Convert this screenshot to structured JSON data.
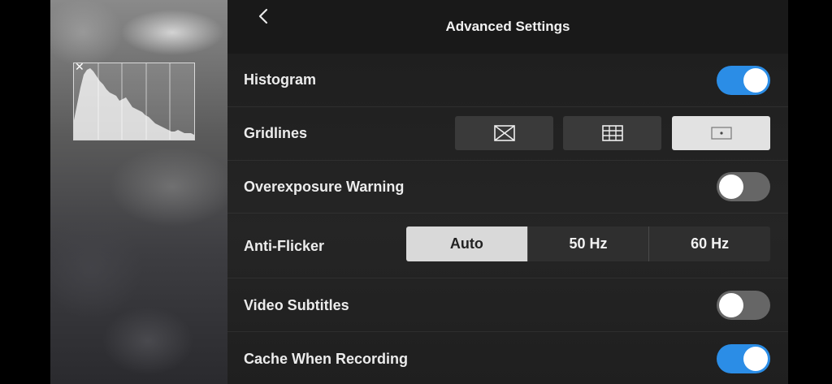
{
  "header": {
    "title": "Advanced Settings",
    "back_icon": "chevron-left-icon"
  },
  "histogram": {
    "close_icon": "close-icon",
    "visible": true
  },
  "settings": {
    "histogram": {
      "label": "Histogram",
      "enabled": true
    },
    "gridlines": {
      "label": "Gridlines",
      "options": [
        {
          "icon": "grid-diagonal-icon",
          "selected": false
        },
        {
          "icon": "grid-3x3-icon",
          "selected": false
        },
        {
          "icon": "center-point-icon",
          "selected": true
        }
      ]
    },
    "overexposure_warning": {
      "label": "Overexposure Warning",
      "enabled": false
    },
    "anti_flicker": {
      "label": "Anti-Flicker",
      "options": [
        "Auto",
        "50 Hz",
        "60 Hz"
      ],
      "selected": "Auto"
    },
    "video_subtitles": {
      "label": "Video Subtitles",
      "enabled": false
    },
    "cache_when_recording": {
      "label": "Cache When Recording",
      "enabled": true
    }
  },
  "colors": {
    "accent": "#2b8de6",
    "toggle_off": "#666666",
    "panel": "#222222"
  }
}
